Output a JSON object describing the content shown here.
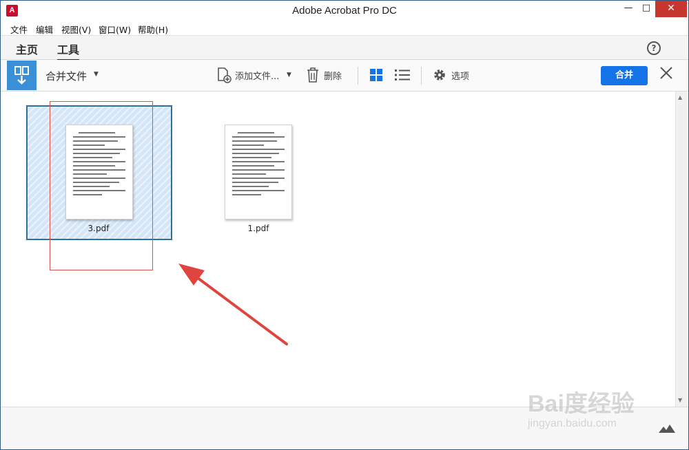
{
  "window": {
    "title": "Adobe Acrobat Pro DC",
    "app_icon": "acrobat-icon"
  },
  "menu": [
    "文件",
    "编辑",
    "视图(V)",
    "窗口(W)",
    "帮助(H)"
  ],
  "nav": {
    "tabs": [
      "主页",
      "工具"
    ],
    "active": "工具",
    "help_icon": "?"
  },
  "toolbar": {
    "tool_name": "合并文件",
    "add_files": "添加文件...",
    "delete": "删除",
    "options": "选项",
    "combine": "合并"
  },
  "files": [
    {
      "name": "3.pdf",
      "selected": true
    },
    {
      "name": "1.pdf",
      "selected": false
    }
  ],
  "watermark": {
    "brand": "Bai度经验",
    "url": "jingyan.baidu.com"
  },
  "colors": {
    "accent": "#1473e6",
    "tool_badge": "#3b8fd6",
    "selection": "#d4e6f7",
    "annotation": "#d9534f"
  }
}
